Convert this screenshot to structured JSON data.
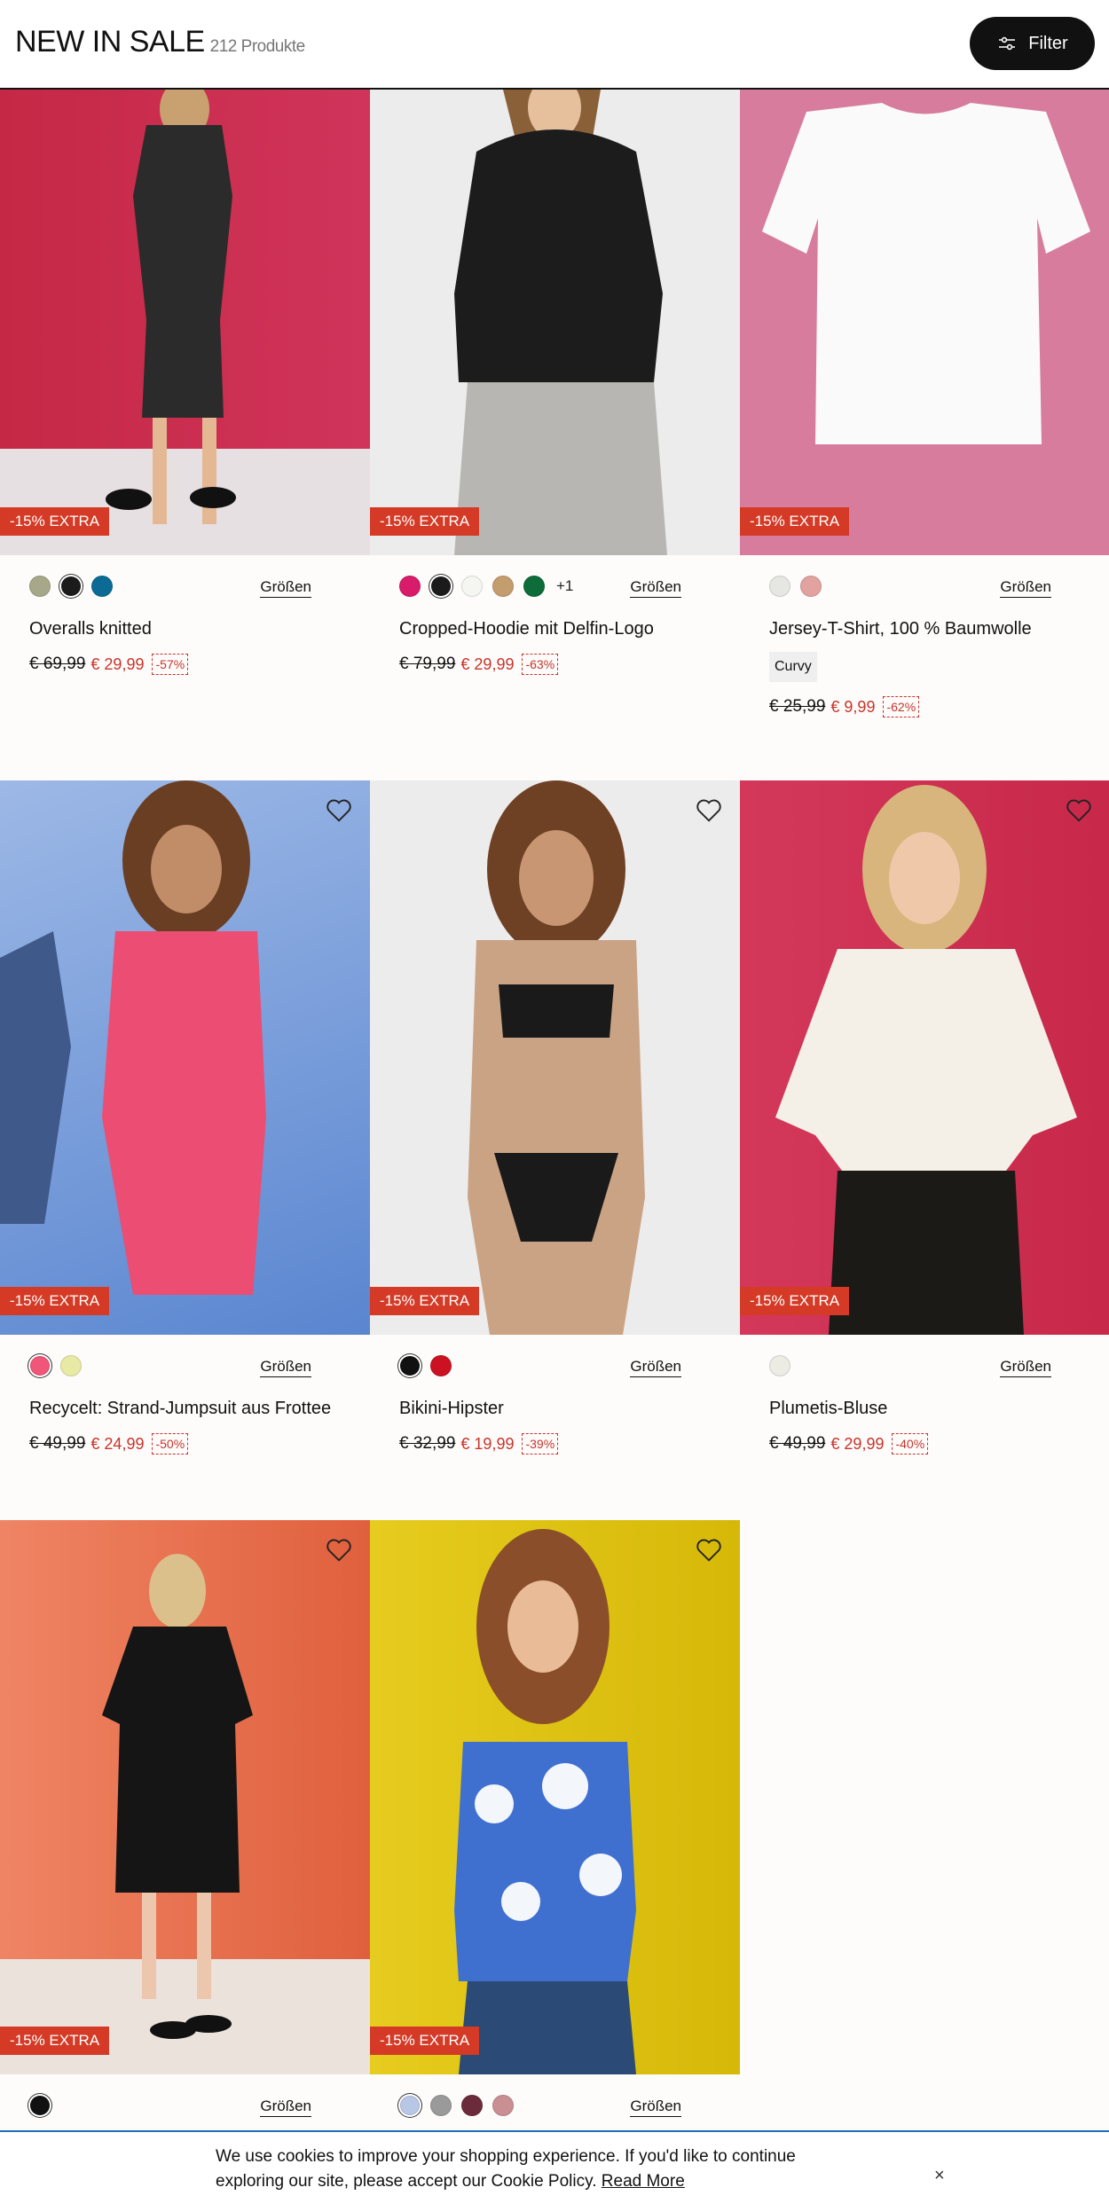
{
  "header": {
    "title": "NEW IN SALE",
    "count": "212 Produkte",
    "filter_label": "Filter"
  },
  "products": [
    {
      "name": "Overalls knitted",
      "badge": "-15% EXTRA",
      "old_price": "€ 69,99",
      "new_price": "€ 29,99",
      "discount": "-57%",
      "sizes_label": "Größen",
      "swatches": [
        "#a6a889",
        "#1b1b1b",
        "#0c6b94"
      ],
      "extra": "",
      "tag": "",
      "has_heart": false
    },
    {
      "name": "Cropped-Hoodie mit Delfin-Logo",
      "badge": "-15% EXTRA",
      "old_price": "€ 79,99",
      "new_price": "€ 29,99",
      "discount": "-63%",
      "sizes_label": "Größen",
      "swatches": [
        "#d81b6a",
        "#1b1b1b",
        "#f5f5f2",
        "#c49d6e",
        "#0d6c3a"
      ],
      "extra": "+1",
      "tag": "",
      "has_heart": false
    },
    {
      "name": "Jersey-T-Shirt, 100 % Baumwolle",
      "badge": "-15% EXTRA",
      "old_price": "€ 25,99",
      "new_price": "€ 9,99",
      "discount": "-62%",
      "sizes_label": "Größen",
      "swatches": [
        "#e6e6e3",
        "#e2a3a0"
      ],
      "extra": "",
      "tag": "Curvy",
      "has_heart": false
    },
    {
      "name": "Recycelt: Strand-Jumpsuit aus Frottee",
      "badge": "-15% EXTRA",
      "old_price": "€ 49,99",
      "new_price": "€ 24,99",
      "discount": "-50%",
      "sizes_label": "Größen",
      "swatches": [
        "#f0557a",
        "#e9e9a6"
      ],
      "extra": "",
      "tag": "",
      "has_heart": true
    },
    {
      "name": "Bikini-Hipster",
      "badge": "-15% EXTRA",
      "old_price": "€ 32,99",
      "new_price": "€ 19,99",
      "discount": "-39%",
      "sizes_label": "Größen",
      "swatches": [
        "#111111",
        "#cc1222"
      ],
      "extra": "",
      "tag": "",
      "has_heart": true
    },
    {
      "name": "Plumetis-Bluse",
      "badge": "-15% EXTRA",
      "old_price": "€ 49,99",
      "new_price": "€ 29,99",
      "discount": "-40%",
      "sizes_label": "Größen",
      "swatches": [
        "#ecebe4"
      ],
      "extra": "",
      "tag": "",
      "has_heart": true
    },
    {
      "name": "",
      "badge": "-15% EXTRA",
      "old_price": "",
      "new_price": "",
      "discount": "",
      "sizes_label": "Größen",
      "swatches": [
        "#111111"
      ],
      "extra": "",
      "tag": "",
      "has_heart": true
    },
    {
      "name": "",
      "badge": "-15% EXTRA",
      "old_price": "",
      "new_price": "",
      "discount": "",
      "sizes_label": "Größen",
      "swatches": [
        "#b9c7e6",
        "#9a9a9a",
        "#6b2b3a",
        "#c98f93"
      ],
      "extra": "",
      "tag": "",
      "has_heart": true
    }
  ],
  "cookie": {
    "text": "We use cookies to improve your shopping experience. If you'd like to continue exploring our site, please accept our Cookie Policy.",
    "link": "Read More",
    "close": "×"
  },
  "icons": {
    "filter": "sliders-icon",
    "wishlist": "heart-icon",
    "close": "close-icon"
  },
  "colors": {
    "accent": "#d43a26",
    "sale": "#c8342a",
    "cookie_border": "#1d6fb8"
  }
}
